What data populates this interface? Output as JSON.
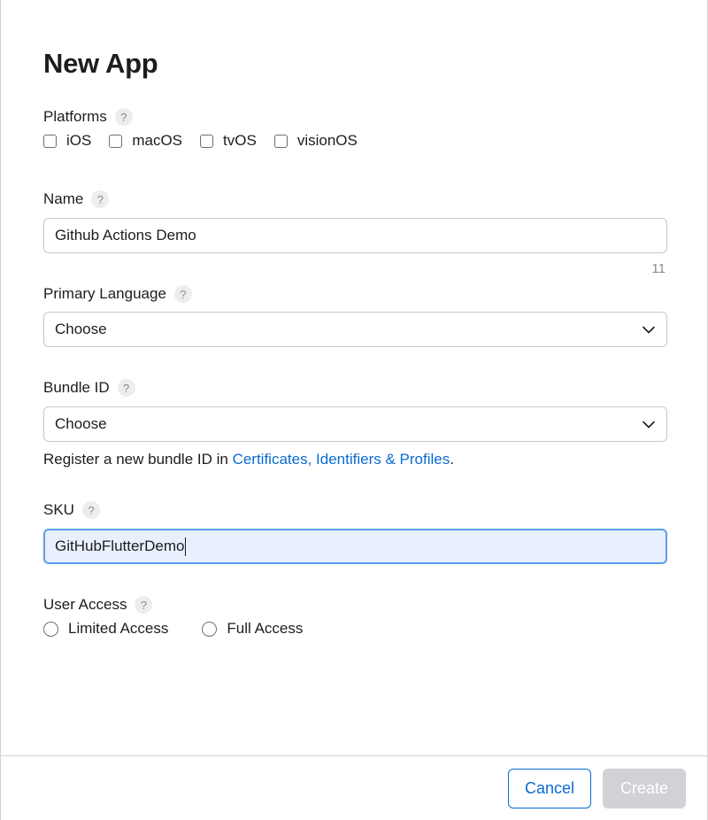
{
  "dialog": {
    "title": "New App"
  },
  "platforms": {
    "label": "Platforms",
    "help": "?",
    "options": [
      "iOS",
      "macOS",
      "tvOS",
      "visionOS"
    ]
  },
  "name": {
    "label": "Name",
    "help": "?",
    "value": "Github Actions Demo",
    "counter": "11"
  },
  "primary_language": {
    "label": "Primary Language",
    "help": "?",
    "selected": "Choose"
  },
  "bundle_id": {
    "label": "Bundle ID",
    "help": "?",
    "selected": "Choose",
    "hint_prefix": "Register a new bundle ID in ",
    "hint_link": "Certificates, Identifiers & Profiles",
    "hint_suffix": "."
  },
  "sku": {
    "label": "SKU",
    "help": "?",
    "value": "GitHubFlutterDemo"
  },
  "user_access": {
    "label": "User Access",
    "help": "?",
    "options": [
      "Limited Access",
      "Full Access"
    ]
  },
  "footer": {
    "cancel_label": "Cancel",
    "create_label": "Create"
  },
  "colors": {
    "accent": "#0b6bd1",
    "focus_bg": "#e8f0fd",
    "disabled_button": "#d1d1d6"
  }
}
